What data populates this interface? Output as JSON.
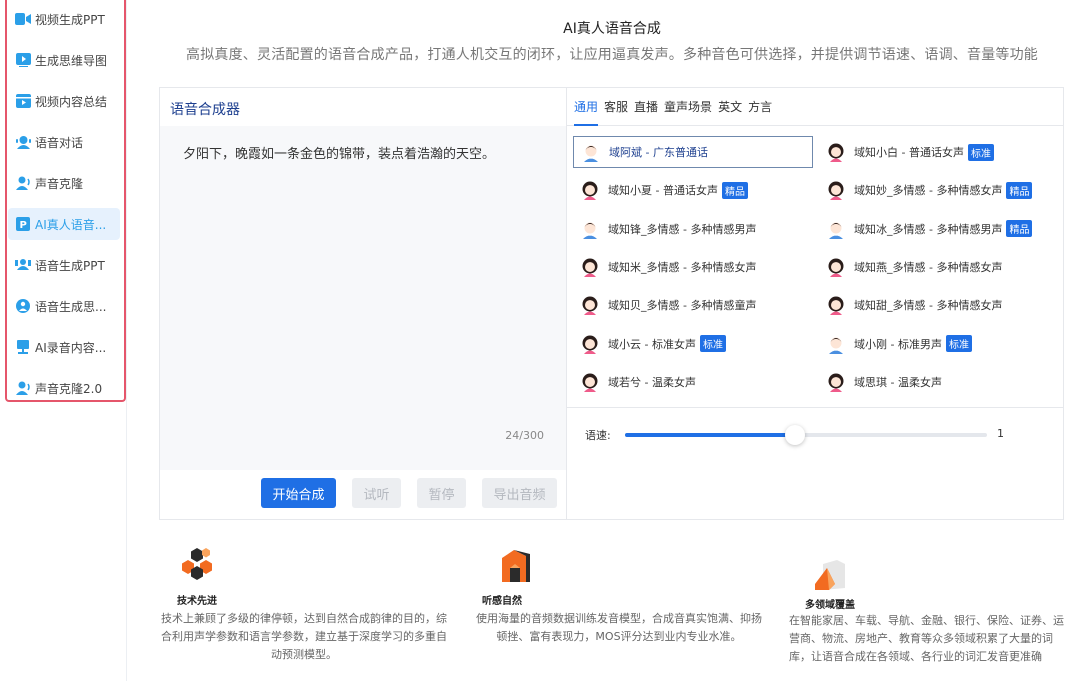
{
  "sidebar": {
    "items": [
      {
        "label": "视频生成PPT",
        "icon": "video-camera-icon"
      },
      {
        "label": "生成思维导图",
        "icon": "play-screen-icon"
      },
      {
        "label": "视频内容总结",
        "icon": "video-summary-icon"
      },
      {
        "label": "语音对话",
        "icon": "chat-person-icon"
      },
      {
        "label": "声音克隆",
        "icon": "voice-clone-icon"
      },
      {
        "label": "AI真人语音...",
        "icon": "p-badge-icon",
        "active": true
      },
      {
        "label": "语音生成PPT",
        "icon": "voice-ppt-icon"
      },
      {
        "label": "语音生成思...",
        "icon": "voice-mindmap-icon"
      },
      {
        "label": "AI录音内容...",
        "icon": "recording-icon"
      },
      {
        "label": "声音克隆2.0",
        "icon": "voice-clone-icon"
      }
    ]
  },
  "header": {
    "title": "AI真人语音合成",
    "subtitle": "高拟真度、灵活配置的语音合成产品，打通人机交互的闭环，让应用逼真发声。多种音色可供选择，并提供调节语速、语调、音量等功能"
  },
  "synth": {
    "title": "语音合成器",
    "text": "夕阳下，晚霞如一条金色的锦带，装点着浩瀚的天空。",
    "char_count": "24/300",
    "buttons": {
      "start": "开始合成",
      "listen": "试听",
      "pause": "暂停",
      "export": "导出音频"
    }
  },
  "tabs": [
    "通用",
    "客服",
    "直播",
    "童声场景",
    "英文",
    "方言"
  ],
  "voices": [
    {
      "name": "域阿斌 - 广东普通话",
      "tag": "",
      "gender": "male",
      "selected": true
    },
    {
      "name": "域知小白 - 普通话女声",
      "tag": "标准",
      "gender": "female"
    },
    {
      "name": "域知小夏 - 普通话女声",
      "tag": "精品",
      "gender": "female"
    },
    {
      "name": "域知妙_多情感 - 多种情感女声",
      "tag": "精品",
      "gender": "female"
    },
    {
      "name": "域知锋_多情感 - 多种情感男声",
      "tag": "",
      "gender": "male"
    },
    {
      "name": "域知冰_多情感 - 多种情感男声",
      "tag": "精品",
      "gender": "male"
    },
    {
      "name": "域知米_多情感 - 多种情感女声",
      "tag": "",
      "gender": "female"
    },
    {
      "name": "域知燕_多情感 - 多种情感女声",
      "tag": "",
      "gender": "female"
    },
    {
      "name": "域知贝_多情感 - 多种情感童声",
      "tag": "",
      "gender": "female"
    },
    {
      "name": "域知甜_多情感 - 多种情感女声",
      "tag": "",
      "gender": "female"
    },
    {
      "name": "域小云 - 标准女声",
      "tag": "标准",
      "gender": "female"
    },
    {
      "name": "域小刚 - 标准男声",
      "tag": "标准",
      "gender": "male"
    },
    {
      "name": "域若兮 - 温柔女声",
      "tag": "",
      "gender": "female"
    },
    {
      "name": "域思琪 - 温柔女声",
      "tag": "",
      "gender": "female"
    }
  ],
  "speed": {
    "label": "语速:",
    "value": "1",
    "fraction": 0.47
  },
  "features": [
    {
      "title": "技术先进",
      "desc": "技术上兼顾了多级的律停顿，达到自然合成韵律的目的，综合利用声学参数和语言学参数，建立基于深度学习的多重自动预测模型。",
      "icon": "hexagon-cluster-icon"
    },
    {
      "title": "听感自然",
      "desc": "使用海量的音频数据训练发音模型，合成音真实饱满、抑扬顿挫、富有表现力，MOS评分达到业内专业水准。",
      "icon": "house-block-icon"
    },
    {
      "title": "多领域覆盖",
      "desc": "在智能家居、车载、导航、金融、银行、保险、证券、运营商、物流、房地产、教育等众多领域积累了大量的词库，让语音合成在各领域、各行业的词汇发音更准确",
      "icon": "cube-shape-icon"
    }
  ],
  "colors": {
    "accent": "#1f6fe5",
    "sidebar_active": "#2b9fe8",
    "highlight_border": "#e5566b"
  }
}
